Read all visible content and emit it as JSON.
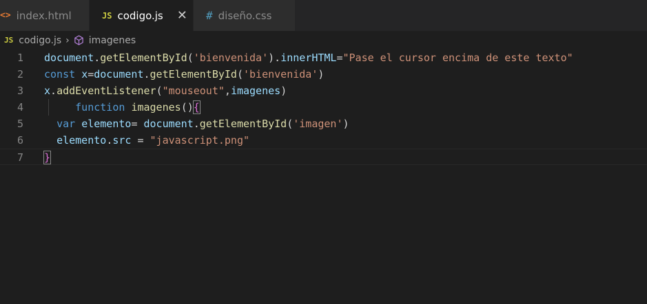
{
  "tabs": [
    {
      "icon": "<>",
      "label": "index.html"
    },
    {
      "icon": "JS",
      "label": "codigo.js",
      "active": true
    },
    {
      "icon": "#",
      "label": "diseño.css"
    }
  ],
  "close_glyph": "✕",
  "breadcrumb": {
    "file_icon": "JS",
    "file": "codigo.js",
    "separator": "›",
    "symbol": "imagenes"
  },
  "editor": {
    "lines": [
      {
        "number": "1",
        "tokens": [
          {
            "t": "var",
            "v": "document"
          },
          {
            "t": "punc",
            "v": "."
          },
          {
            "t": "fn",
            "v": "getElementById"
          },
          {
            "t": "punc",
            "v": "("
          },
          {
            "t": "str",
            "v": "'bienvenida'"
          },
          {
            "t": "punc",
            "v": ")."
          },
          {
            "t": "var",
            "v": "innerHTML"
          },
          {
            "t": "punc",
            "v": "="
          },
          {
            "t": "str",
            "v": "\"Pase el cursor encima de este texto\""
          }
        ]
      },
      {
        "number": "2",
        "tokens": [
          {
            "t": "kw",
            "v": "const"
          },
          {
            "t": "punc",
            "v": " "
          },
          {
            "t": "var",
            "v": "x"
          },
          {
            "t": "punc",
            "v": "="
          },
          {
            "t": "var",
            "v": "document"
          },
          {
            "t": "punc",
            "v": "."
          },
          {
            "t": "fn",
            "v": "getElementById"
          },
          {
            "t": "punc",
            "v": "("
          },
          {
            "t": "str",
            "v": "'bienvenida'"
          },
          {
            "t": "punc",
            "v": ")"
          }
        ]
      },
      {
        "number": "3",
        "tokens": [
          {
            "t": "var",
            "v": "x"
          },
          {
            "t": "punc",
            "v": "."
          },
          {
            "t": "fn",
            "v": "addEventListener"
          },
          {
            "t": "punc",
            "v": "("
          },
          {
            "t": "str",
            "v": "\"mouseout\""
          },
          {
            "t": "punc",
            "v": ","
          },
          {
            "t": "var",
            "v": "imagenes"
          },
          {
            "t": "punc",
            "v": ")"
          }
        ]
      },
      {
        "number": "4",
        "tokens": [
          {
            "t": "punc",
            "v": "     "
          },
          {
            "t": "kw",
            "v": "function"
          },
          {
            "t": "punc",
            "v": " "
          },
          {
            "t": "fn",
            "v": "imagenes"
          },
          {
            "t": "punc",
            "v": "()"
          },
          {
            "t": "brace",
            "v": "{"
          }
        ]
      },
      {
        "number": "5",
        "tokens": [
          {
            "t": "punc",
            "v": "  "
          },
          {
            "t": "kw",
            "v": "var"
          },
          {
            "t": "punc",
            "v": " "
          },
          {
            "t": "var",
            "v": "elemento"
          },
          {
            "t": "punc",
            "v": "= "
          },
          {
            "t": "var",
            "v": "document"
          },
          {
            "t": "punc",
            "v": "."
          },
          {
            "t": "fn",
            "v": "getElementById"
          },
          {
            "t": "punc",
            "v": "("
          },
          {
            "t": "str",
            "v": "'imagen'"
          },
          {
            "t": "punc",
            "v": ")"
          }
        ]
      },
      {
        "number": "6",
        "tokens": [
          {
            "t": "punc",
            "v": "  "
          },
          {
            "t": "var",
            "v": "elemento"
          },
          {
            "t": "punc",
            "v": "."
          },
          {
            "t": "var",
            "v": "src"
          },
          {
            "t": "punc",
            "v": " = "
          },
          {
            "t": "str",
            "v": "\"javascript.png\""
          }
        ]
      },
      {
        "number": "7",
        "tokens": [
          {
            "t": "brace",
            "v": "}"
          }
        ]
      }
    ]
  }
}
